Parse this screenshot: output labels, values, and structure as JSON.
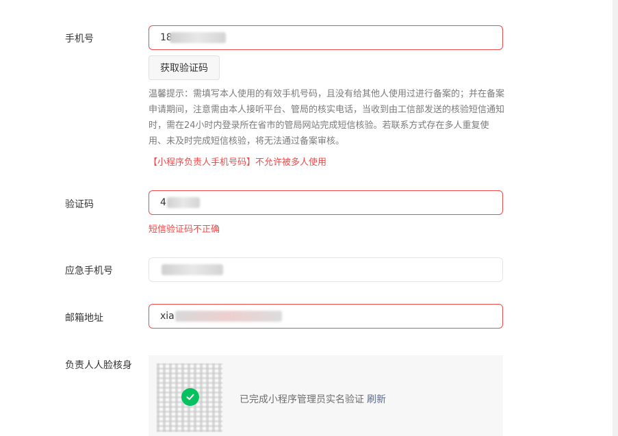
{
  "phone": {
    "label": "手机号",
    "value_visible_prefix": "18",
    "get_code_button": "获取验证码",
    "tip": "温馨提示：需填写本人使用的有效手机号码，且没有给其他人使用过进行备案的；并在备案申请期间，注意需由本人接听平台、管局的核实电话，当收到由工信部发送的核验短信通知时，需在24小时内登录所在省市的管局网站完成短信核验。若联系方式存在多人重复使用、未及时完成短信核验，将无法通过备案审核。",
    "error": "【小程序负责人手机号码】不允许被多人使用"
  },
  "code": {
    "label": "验证码",
    "value_visible_prefix": "4",
    "error": "短信验证码不正确"
  },
  "emergency_phone": {
    "label": "应急手机号"
  },
  "email": {
    "label": "邮箱地址",
    "value_visible_prefix": "xia"
  },
  "face_verify": {
    "label": "负责人人脸核身",
    "status_text": "已完成小程序管理员实名验证",
    "refresh_link": "刷新"
  },
  "colors": {
    "error": "#f04a4a",
    "success": "#07c160",
    "link": "#576b95"
  }
}
